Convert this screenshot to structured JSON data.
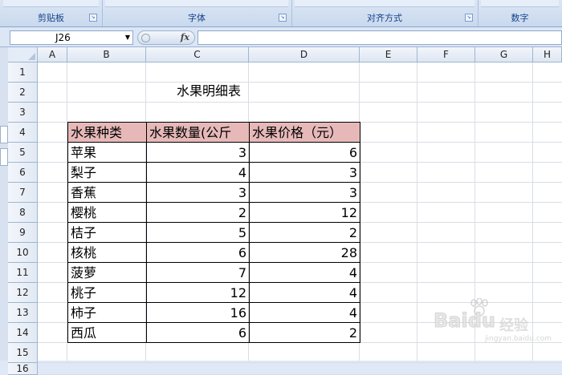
{
  "ribbon": {
    "groups": [
      {
        "label": "剪贴板"
      },
      {
        "label": "字体"
      },
      {
        "label": "对齐方式"
      },
      {
        "label": "数字"
      }
    ]
  },
  "formula_bar": {
    "name_box": "J26",
    "fx_label": "fx",
    "formula": ""
  },
  "columns": [
    "A",
    "B",
    "C",
    "D",
    "E",
    "F",
    "G",
    "H"
  ],
  "rows": [
    "1",
    "2",
    "3",
    "4",
    "5",
    "6",
    "7",
    "8",
    "9",
    "10",
    "11",
    "12",
    "13",
    "14",
    "15",
    "16"
  ],
  "sheet": {
    "title": "水果明细表",
    "headers": [
      "水果种类",
      "水果数量(公斤",
      "水果价格（元）"
    ],
    "data": [
      {
        "name": "苹果",
        "qty": "3",
        "price": "6"
      },
      {
        "name": "梨子",
        "qty": "4",
        "price": "3"
      },
      {
        "name": "香蕉",
        "qty": "3",
        "price": "3"
      },
      {
        "name": "樱桃",
        "qty": "2",
        "price": "12"
      },
      {
        "name": "桔子",
        "qty": "5",
        "price": "2"
      },
      {
        "name": "核桃",
        "qty": "6",
        "price": "28"
      },
      {
        "name": "菠萝",
        "qty": "7",
        "price": "4"
      },
      {
        "name": "桃子",
        "qty": "12",
        "price": "4"
      },
      {
        "name": "柿子",
        "qty": "16",
        "price": "4"
      },
      {
        "name": "西瓜",
        "qty": "6",
        "price": "2"
      }
    ]
  },
  "watermark": {
    "text": "Baidu",
    "cn": "经验",
    "url": "jingyan.baidu.com"
  },
  "colors": {
    "header_fill": "#e6b9b8",
    "sheet_bg": "#ffffff",
    "ribbon_label": "#15428b"
  }
}
